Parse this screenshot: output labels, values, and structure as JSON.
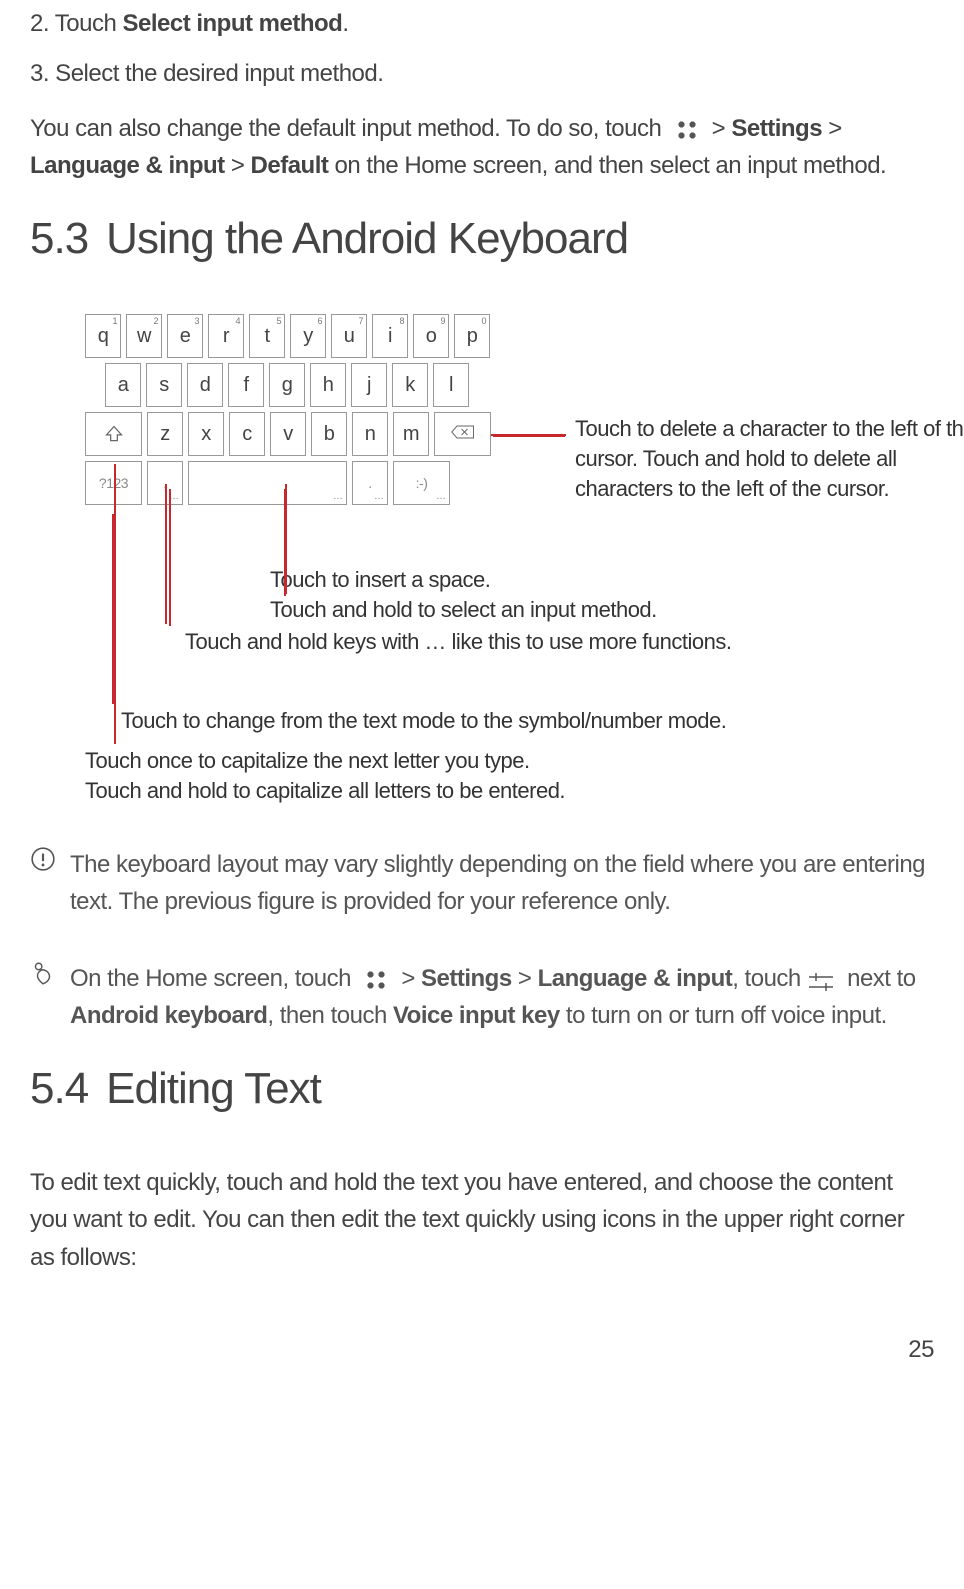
{
  "step2_prefix": "2. Touch ",
  "step2_bold": "Select input method",
  "step2_suffix": ".",
  "step3": "3. Select the desired input method.",
  "p1_a": "You can also change the default input method. To do so, touch ",
  "p1_b": "  > ",
  "p1_settings": "Settings",
  "p1_c": " > ",
  "p1_lang": "Language & input",
  "p1_d": " > ",
  "p1_default": "Default",
  "p1_e": " on the Home screen, and then select an input method.",
  "h53_num": "5.3",
  "h53_title": "Using the Android Keyboard",
  "kb": {
    "row1": [
      {
        "k": "q",
        "s": "1"
      },
      {
        "k": "w",
        "s": "2"
      },
      {
        "k": "e",
        "s": "3"
      },
      {
        "k": "r",
        "s": "4"
      },
      {
        "k": "t",
        "s": "5"
      },
      {
        "k": "y",
        "s": "6"
      },
      {
        "k": "u",
        "s": "7"
      },
      {
        "k": "i",
        "s": "8"
      },
      {
        "k": "o",
        "s": "9"
      },
      {
        "k": "p",
        "s": "0"
      }
    ],
    "row2": [
      "a",
      "s",
      "d",
      "f",
      "g",
      "h",
      "j",
      "k",
      "l"
    ],
    "row3": [
      "z",
      "x",
      "c",
      "v",
      "b",
      "n",
      "m"
    ],
    "sym": "?123",
    "comma": ",",
    "period": ".",
    "emote": ":-)"
  },
  "c_delete": "Touch to delete a character to the left of the cursor. Touch and hold to delete all characters to the left of the cursor.",
  "c_space1": "Touch to insert a space.",
  "c_space2": "Touch and hold to select an input method.",
  "c_comma": "Touch and hold keys with … like this to use more functions.",
  "c_sym": "Touch to change from the text mode to the symbol/number mode.",
  "c_shift1": "Touch once to capitalize the next letter you type.",
  "c_shift2": "Touch and hold to capitalize all letters to be entered.",
  "note1": "The keyboard layout may vary slightly depending on the field where you are entering text. The previous figure is provided for your reference only.",
  "note2_a": "On the Home screen, touch ",
  "note2_b": "  > ",
  "note2_settings": "Settings",
  "note2_c": " > ",
  "note2_lang": "Language & input",
  "note2_d": ", touch ",
  "note2_e": " next to ",
  "note2_android": "Android keyboard",
  "note2_f": ", then touch ",
  "note2_voice": "Voice input key",
  "note2_g": " to turn on or turn off voice input.",
  "h54_num": "5.4",
  "h54_title": "Editing Text",
  "p54": "To edit text quickly, touch and hold the text you have entered, and choose the content you want to edit. You can then edit the text quickly using icons in the upper right corner as follows:",
  "pagenum": "25"
}
